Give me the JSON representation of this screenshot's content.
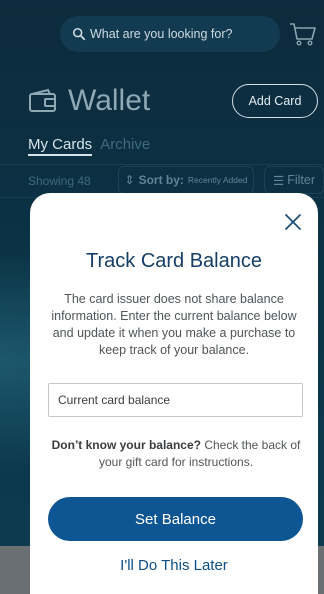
{
  "header": {
    "search_placeholder": "What are you looking for?",
    "icons": [
      "search-icon",
      "cart-icon"
    ]
  },
  "wallet": {
    "title": "Wallet",
    "add_card_label": "Add Card",
    "tabs": [
      {
        "label": "My Cards",
        "active": true
      },
      {
        "label": "Archive",
        "active": false
      }
    ],
    "showing": "Showing 48",
    "sort_label": "Sort by:",
    "sort_value": "Recently Added",
    "filter_label": "Filter"
  },
  "modal": {
    "title": "Track Card Balance",
    "description": "The card issuer does not share balance information. Enter the current balance below and update it when you make a purchase to keep track of your balance.",
    "input_placeholder": "Current card balance",
    "input_value": "",
    "help_bold": "Don’t know your balance?",
    "help_text": " Check the back of your gift card for instructions.",
    "primary_button": "Set Balance",
    "secondary_link": "I'll Do This Later"
  },
  "colors": {
    "primary": "#0d5593",
    "title": "#143e66",
    "background_dark": "#0b3346"
  }
}
